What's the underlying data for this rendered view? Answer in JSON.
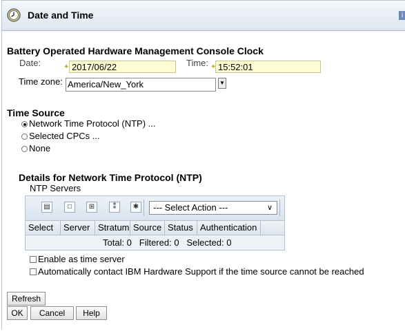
{
  "window": {
    "title": "Date and Time",
    "help_label": "i"
  },
  "clock_section": {
    "heading": "Battery Operated Hardware Management Console Clock",
    "date_label": "Date:",
    "date_value": "2017/06/22",
    "time_label": "Time:",
    "time_value": "15:52:01",
    "required_marker": "✦",
    "timezone_label": "Time zone:",
    "timezone_value": "America/New_York"
  },
  "time_source": {
    "heading": "Time Source",
    "options": [
      {
        "label": "Network Time Protocol (NTP) ...",
        "selected": true
      },
      {
        "label": "Selected CPCs ...",
        "selected": false
      },
      {
        "label": "None",
        "selected": false
      }
    ]
  },
  "ntp_details": {
    "heading": "Details for Network Time Protocol (NTP)",
    "servers_label": "NTP Servers",
    "action_select": "--- Select Action ---",
    "columns": [
      "Select",
      "Server",
      "Stratum",
      "Source",
      "Status",
      "Authentication"
    ],
    "footer": "Total: 0   Filtered: 0   Selected: 0",
    "checkbox_enable": "Enable as time server",
    "checkbox_contact": "Automatically contact IBM Hardware Support if the time source cannot be reached"
  },
  "buttons": {
    "refresh": "Refresh",
    "ok": "OK",
    "cancel": "Cancel",
    "help": "Help"
  },
  "colors": {
    "input_bg": "#fdfcd3",
    "toolbar_bg": "#dfe6ef"
  }
}
